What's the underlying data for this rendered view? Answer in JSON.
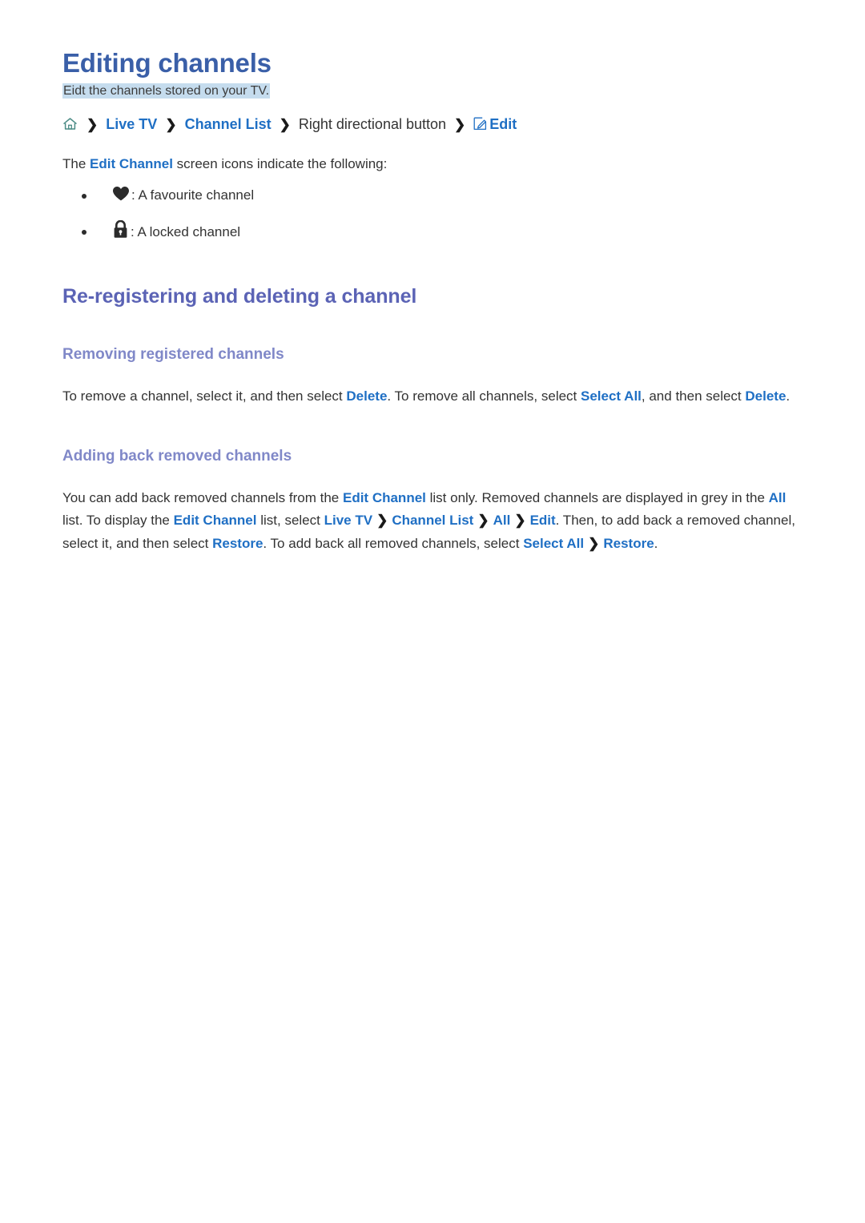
{
  "document": {
    "title": "Editing channels",
    "subtitle": "Eidt the channels stored on your TV.",
    "subtitle_highlight_color": "#c5dcee",
    "title_color": "#3a5fa8"
  },
  "breadcrumb": {
    "home_icon": "home-icon",
    "items": [
      {
        "label": "Live TV",
        "type": "link"
      },
      {
        "label": "Channel List",
        "type": "link"
      },
      {
        "label": "Right directional button",
        "type": "plain"
      },
      {
        "label": "Edit",
        "type": "link",
        "icon": "edit-pencil-icon"
      }
    ],
    "separator": "❯"
  },
  "intro": {
    "part1": "The ",
    "link1": "Edit Channel",
    "part2": " screen icons indicate the following:"
  },
  "icon_legend": [
    {
      "icon": "heart-icon",
      "text": ": A favourite channel"
    },
    {
      "icon": "lock-icon",
      "text": ": A locked channel"
    }
  ],
  "sections": [
    {
      "heading": "Re-registering and deleting a channel",
      "heading_color": "#5b63b5",
      "subsections": [
        {
          "heading": "Removing registered channels",
          "heading_color": "#8088c8",
          "paragraph": {
            "t1": "To remove a channel, select it, and then select ",
            "l1": "Delete",
            "t2": ". To remove all channels, select ",
            "l2": "Select All",
            "t3": ", and then select ",
            "l3": "Delete",
            "t4": "."
          }
        },
        {
          "heading": "Adding back removed channels",
          "heading_color": "#8088c8",
          "paragraph": {
            "t1": "You can add back removed channels from the ",
            "l1": "Edit Channel",
            "t2": " list only. Removed channels are displayed in grey in the ",
            "l2": "All",
            "t3": " list. To display the ",
            "l3": "Edit Channel",
            "t4": " list, select ",
            "l4": "Live TV",
            "l5": "Channel List",
            "l6": "All",
            "l7": "Edit",
            "t5": ". Then, to add back a removed channel, select it, and then select ",
            "l8": "Restore",
            "t6": ". To add back all removed channels, select ",
            "l9": "Select All",
            "l10": "Restore",
            "t7": "."
          }
        }
      ]
    }
  ],
  "colors": {
    "link": "#1f6fc4",
    "body_text": "#333333",
    "home_icon": "#4c8c86"
  }
}
